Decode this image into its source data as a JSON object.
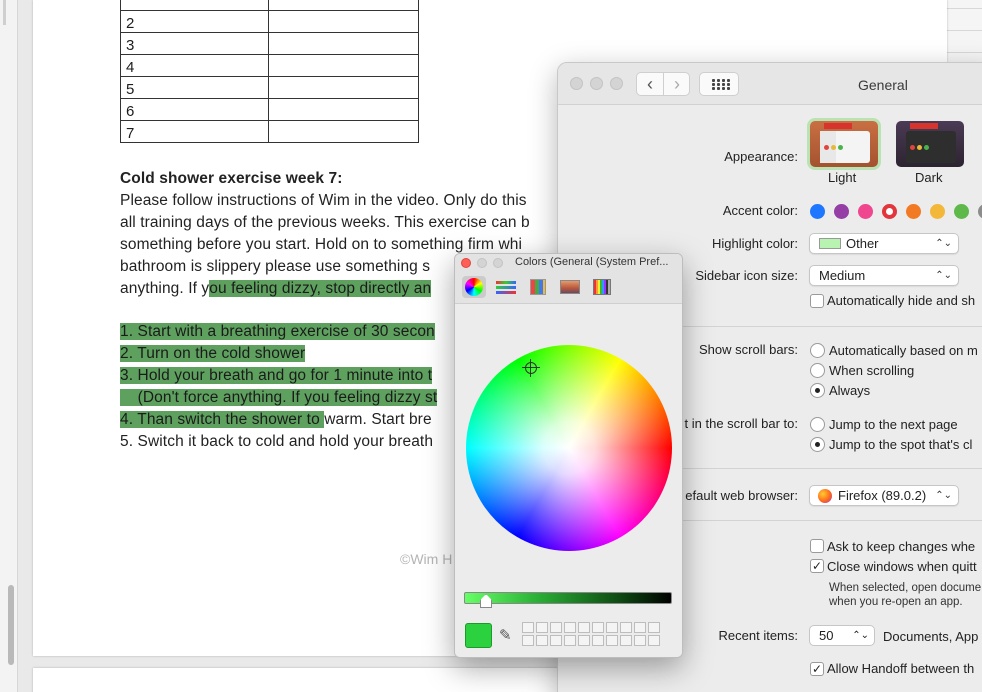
{
  "document": {
    "table_rows": [
      "2",
      "3",
      "4",
      "5",
      "6",
      "7"
    ],
    "heading": "Cold shower exercise week 7:",
    "paragraph_lines": [
      "Please follow instructions of Wim in the video. Only do this",
      "all training days of the previous weeks. This exercise can b",
      "something before you start. Hold on to something firm whi",
      "bathroom is slippery please use something s"
    ],
    "line5_plain": "anything. If y",
    "line5_highlight": "ou feeling dizzy, stop directly an",
    "steps": {
      "s1": "1. Start with a breathing exercise of 30 secon",
      "s2": "2. Turn on the cold shower",
      "s3": "3. Hold your breath and go for 1 minute into t",
      "s3b": "    (Don't force anything. If you feeling dizzy st",
      "s4_hl": "4. Than switch the shower to ",
      "s4_plain": "warm. Start bre",
      "s5": "5. Switch it back to cold and hold your breath"
    },
    "footer": "©Wim H",
    "highlight_color": "#5ea15f"
  },
  "prefs": {
    "title": "General",
    "appearance_label": "Appearance:",
    "appearance_options": [
      "Light",
      "Dark"
    ],
    "accent_label": "Accent color:",
    "accent_colors": [
      "#1e78ff",
      "#953fa6",
      "#f0458f",
      "#e2353c",
      "#f37a24",
      "#f3b83a",
      "#5eb94a",
      "#8c8c8c"
    ],
    "highlight_label": "Highlight color:",
    "highlight_value": "Other",
    "sidebar_label": "Sidebar icon size:",
    "sidebar_value": "Medium",
    "auto_hide": "Automatically hide and sh",
    "scroll_label": "Show scroll bars:",
    "scroll_options": [
      "Automatically based on m",
      "When scrolling",
      "Always"
    ],
    "click_label": "t in the scroll bar to:",
    "click_options": [
      "Jump to the next page",
      "Jump to the spot that's cl"
    ],
    "browser_label": "efault web browser:",
    "browser_value": "Firefox (89.0.2)",
    "ask_keep": "Ask to keep changes whe",
    "close_windows": "Close windows when quitt",
    "close_note_1": "When selected, open docume",
    "close_note_2": "when you re-open an app.",
    "recent_label": "Recent items:",
    "recent_value": "50",
    "recent_suffix": "Documents, App",
    "handoff": "Allow Handoff between th"
  },
  "colors_panel": {
    "title": "Colors (General (System Pref...",
    "current_color": "#2bd13e"
  }
}
